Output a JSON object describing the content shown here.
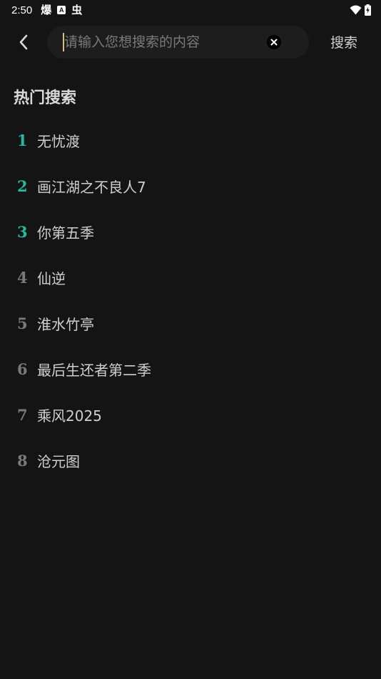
{
  "status_bar": {
    "time": "2:50",
    "notifications": [
      {
        "icon": "bao-notification-icon",
        "glyph": "爆"
      },
      {
        "icon": "a-box-notification-icon",
        "glyph": "A"
      },
      {
        "icon": "bug-notification-icon",
        "glyph": "虫"
      }
    ],
    "right_icons": [
      "wifi-icon",
      "battery-charging-icon"
    ]
  },
  "header": {
    "back_icon": "chevron-left-icon",
    "search_placeholder": "请输入您想搜索的内容",
    "search_value": "",
    "clear_icon": "close-icon",
    "search_button": "搜索"
  },
  "hot_search": {
    "title": "热门搜索",
    "top_rank_color": "#27b7a3",
    "rank_color": "#7a7a7a",
    "items": [
      {
        "rank": "1",
        "label": "无忧渡"
      },
      {
        "rank": "2",
        "label": "画江湖之不良人7"
      },
      {
        "rank": "3",
        "label": "你第五季"
      },
      {
        "rank": "4",
        "label": "仙逆"
      },
      {
        "rank": "5",
        "label": "淮水竹亭"
      },
      {
        "rank": "6",
        "label": "最后生还者第二季"
      },
      {
        "rank": "7",
        "label": "乘风2025"
      },
      {
        "rank": "8",
        "label": "沧元图"
      }
    ]
  },
  "colors": {
    "background": "#141414",
    "search_box": "#1d1d1d",
    "caret": "#d8c07a",
    "accent": "#27b7a3"
  }
}
